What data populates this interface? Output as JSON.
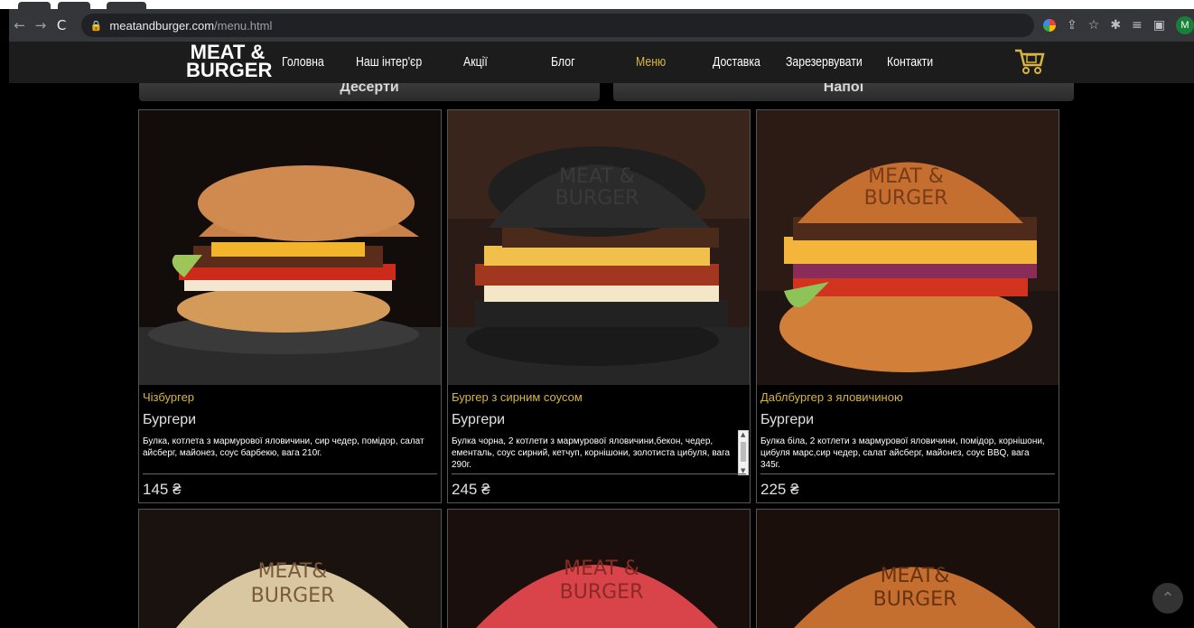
{
  "browser": {
    "url_host": "meatandburger.com",
    "url_path": "/menu.html",
    "profile_initial": "M"
  },
  "site": {
    "logo_line1": "MEAT &",
    "logo_line2": "BURGER",
    "nav": [
      "Головна",
      "Наш інтер'єр",
      "Акції",
      "Блог",
      "Меню",
      "Доставка",
      "Зарезервувати",
      "Контакти"
    ],
    "active_nav": "Меню",
    "categories": [
      "Десерти",
      "Напої"
    ]
  },
  "menu": [
    {
      "title": "Чізбургер",
      "category": "Бургери",
      "description": "Булка, котлета з мармурової яловичини, сир чедер, помідор, салат айсберг, майонез, соус барбекю, вага 210г.",
      "price": "145 ₴"
    },
    {
      "title": "Бургер з сирним соусом",
      "category": "Бургери",
      "description": "Булка чорна, 2 котлети з мармурової яловичини,бекон, чедер, ементаль, соус сирний, кетчуп, корнішони, золотиста цибуля, вага 290г.",
      "price": "245 ₴"
    },
    {
      "title": "Даблбургер з яловичиною",
      "category": "Бургери",
      "description": "Булка біла, 2 котлети з мармурової яловичини, помідор, корнішони, цибуля марс,сир чедер, салат айсберг, майонез, соус BBQ, вага 345г.",
      "price": "225 ₴"
    }
  ],
  "colors": {
    "accent": "#d8b541",
    "header_bg": "#1c1c1c",
    "page_bg": "#000000"
  }
}
